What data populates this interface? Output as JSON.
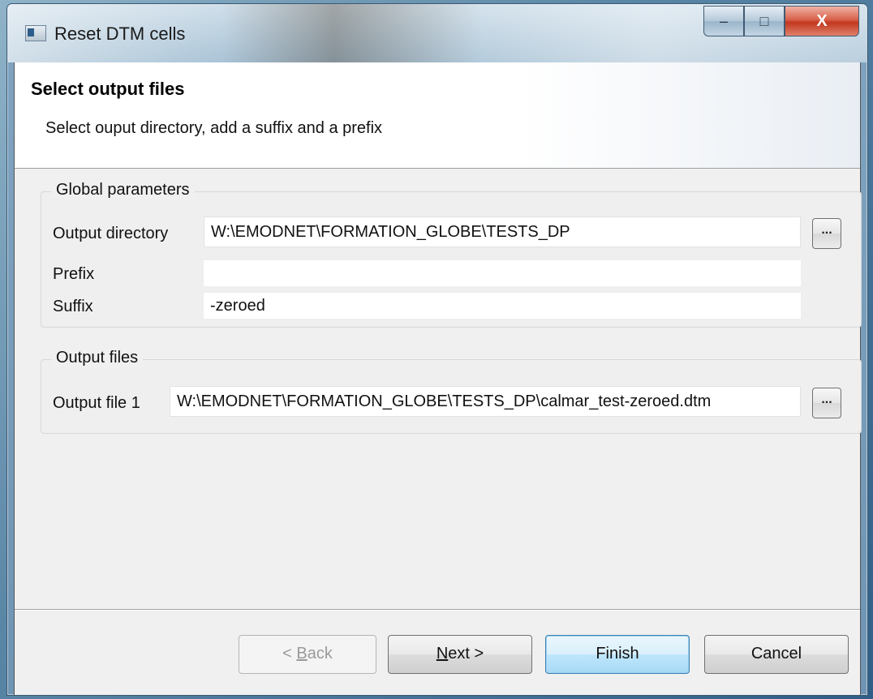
{
  "window": {
    "title": "Reset DTM cells",
    "controls": {
      "minimize": "–",
      "maximize": "□",
      "close": "X"
    }
  },
  "header": {
    "title": "Select output files",
    "description": "Select ouput directory, add a suffix and a prefix"
  },
  "global_parameters": {
    "label": "Global parameters",
    "output_directory_label": "Output directory",
    "output_directory_value": "W:\\EMODNET\\FORMATION_GLOBE\\TESTS_DP",
    "prefix_label": "Prefix",
    "prefix_value": "",
    "suffix_label": "Suffix",
    "suffix_value": "-zeroed",
    "browse_label": "..."
  },
  "output_files": {
    "label": "Output files",
    "output_file_1_label": "Output file 1",
    "output_file_1_value": "W:\\EMODNET\\FORMATION_GLOBE\\TESTS_DP\\calmar_test-zeroed.dtm",
    "browse_label": "..."
  },
  "buttons": {
    "back_prefix": "< ",
    "back_mnemonic": "B",
    "back_rest": "ack",
    "next_mnemonic": "N",
    "next_rest": "ext >",
    "finish": "Finish",
    "cancel": "Cancel"
  }
}
